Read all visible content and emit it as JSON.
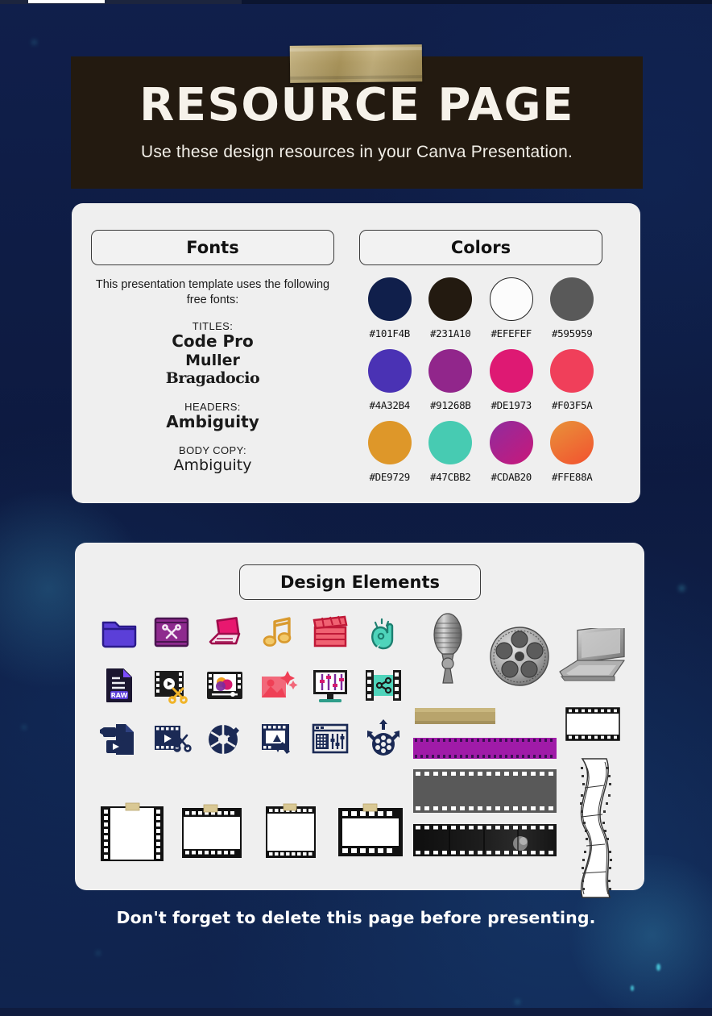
{
  "header": {
    "title": "RESOURCE PAGE",
    "subtitle": "Use these design resources in your Canva Presentation.",
    "tape_icon": "washi-tape"
  },
  "fonts_panel": {
    "heading": "Fonts",
    "intro": "This presentation template uses the following free fonts:",
    "groups": [
      {
        "label": "TITLES:",
        "names": [
          "Code Pro",
          "Muller",
          "Bragadocio"
        ]
      },
      {
        "label": "HEADERS:",
        "names": [
          "Ambiguity"
        ]
      },
      {
        "label": "BODY COPY:",
        "names": [
          "Ambiguity"
        ]
      }
    ]
  },
  "colors_panel": {
    "heading": "Colors",
    "swatches": [
      {
        "hex": "#101F4B",
        "fill": "#101F4B",
        "outlined": false
      },
      {
        "hex": "#231A10",
        "fill": "#231A10",
        "outlined": false
      },
      {
        "hex": "#EFEFEF",
        "fill": "#FCFCFC",
        "outlined": true
      },
      {
        "hex": "#595959",
        "fill": "#595959",
        "outlined": false
      },
      {
        "hex": "#4A32B4",
        "fill": "#4A32B4",
        "outlined": false
      },
      {
        "hex": "#91268B",
        "fill": "#91268B",
        "outlined": false
      },
      {
        "hex": "#DE1973",
        "fill": "#DE1973",
        "outlined": false
      },
      {
        "hex": "#F03F5A",
        "fill": "#F03F5A",
        "outlined": false
      },
      {
        "hex": "#DE9729",
        "fill": "#DE9729",
        "outlined": false
      },
      {
        "hex": "#47CBB2",
        "fill": "#47CBB2",
        "outlined": false
      },
      {
        "hex": "#CDAB20",
        "fill": "linear-gradient(140deg,#8F2C9E 0%,#C9187A 100%)",
        "outlined": false
      },
      {
        "hex": "#FFE88A",
        "fill": "linear-gradient(150deg,#E8933A 0%,#F2512F 100%)",
        "outlined": false
      }
    ]
  },
  "design_panel": {
    "heading": "Design Elements",
    "icons": [
      "folder-icon",
      "film-scissors-icon",
      "laptop-icon",
      "music-note-icon",
      "clapperboard-icon",
      "hand-gesture-icon",
      "raw-file-icon",
      "film-cut-icon",
      "video-player-icon",
      "image-sparkle-icon",
      "monitor-equalizer-icon",
      "film-share-icon",
      "video-file-icon",
      "film-play-cut-icon",
      "camera-shutter-icon",
      "film-magic-wand-icon",
      "mixer-console-icon",
      "reel-distribute-icon"
    ],
    "frames": [
      "film-frame-tall",
      "film-frame-topbottom",
      "film-frame-narrow",
      "film-frame-wide"
    ],
    "photos": [
      "microphone-photo",
      "film-reel-photo",
      "laptop-photo"
    ],
    "right_elements": [
      "washi-tape-strip",
      "film-frame-outline",
      "purple-filmstrip",
      "gray-filmstrip",
      "dark-filmstrip-photo",
      "wavy-filmstrip"
    ]
  },
  "footer": {
    "note": "Don't forget to delete this page before presenting."
  }
}
